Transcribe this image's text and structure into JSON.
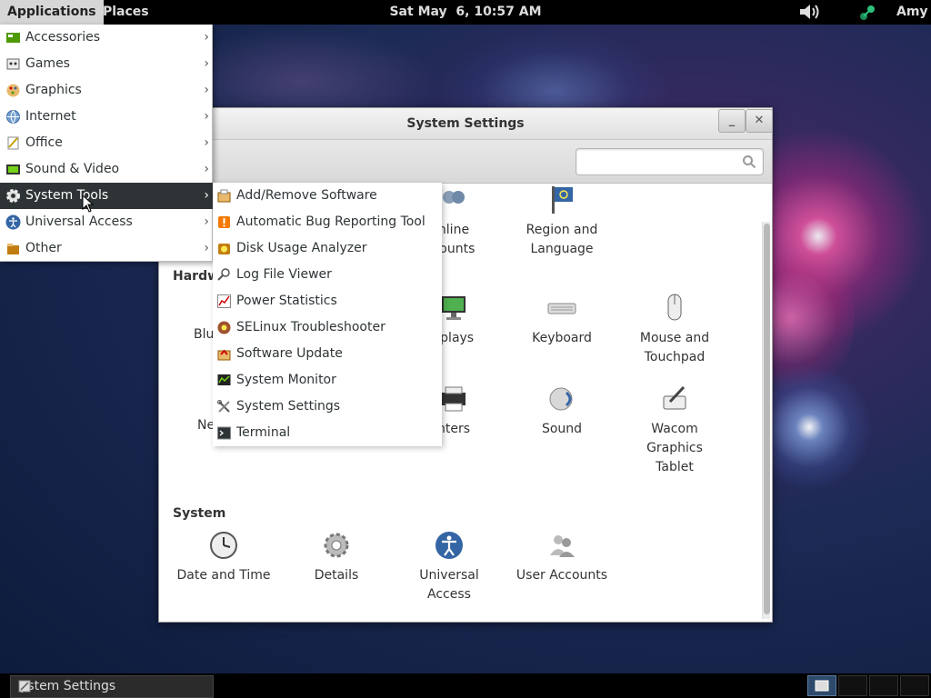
{
  "top_panel": {
    "applications": "Applications",
    "places": "Places",
    "clock": "Sat May  6, 10:57 AM",
    "user": "Amy"
  },
  "window": {
    "title": "System Settings",
    "minimize": "_",
    "close": "✕",
    "search_placeholder": ""
  },
  "sections": {
    "personal_items": [
      {
        "label_lines": [
          "nline",
          "counts"
        ]
      },
      {
        "label_lines": [
          "Region and",
          "Language"
        ]
      }
    ],
    "hardware": {
      "heading": "Hardw",
      "partial_items": [
        "Blu",
        "Ne"
      ],
      "items": [
        {
          "label_lines": [
            "splays",
            ""
          ]
        },
        {
          "label_lines": [
            "Keyboard",
            ""
          ]
        },
        {
          "label_lines": [
            "Mouse and",
            "Touchpad"
          ]
        },
        {
          "label_lines": [
            "nters",
            ""
          ]
        },
        {
          "label_lines": [
            "Sound",
            ""
          ]
        },
        {
          "label_lines": [
            "Wacom",
            "Graphics",
            "Tablet"
          ]
        }
      ]
    },
    "system": {
      "heading": "System",
      "items": [
        {
          "label_lines": [
            "Date and Time",
            ""
          ]
        },
        {
          "label_lines": [
            "Details",
            ""
          ]
        },
        {
          "label_lines": [
            "Universal",
            "Access"
          ]
        },
        {
          "label_lines": [
            "User Accounts",
            ""
          ]
        }
      ]
    }
  },
  "app_menu": {
    "items": [
      {
        "label": "Accessories",
        "icon": "accessories-icon"
      },
      {
        "label": "Games",
        "icon": "games-icon"
      },
      {
        "label": "Graphics",
        "icon": "graphics-icon"
      },
      {
        "label": "Internet",
        "icon": "internet-icon"
      },
      {
        "label": "Office",
        "icon": "office-icon"
      },
      {
        "label": "Sound & Video",
        "icon": "sound-video-icon"
      },
      {
        "label": "System Tools",
        "icon": "system-tools-icon",
        "active": true
      },
      {
        "label": "Universal Access",
        "icon": "universal-access-icon"
      },
      {
        "label": "Other",
        "icon": "other-icon"
      }
    ],
    "arrow": "›"
  },
  "system_tools_menu": {
    "items": [
      {
        "label": "Add/Remove Software"
      },
      {
        "label": "Automatic Bug Reporting Tool"
      },
      {
        "label": "Disk Usage Analyzer"
      },
      {
        "label": "Log File Viewer"
      },
      {
        "label": "Power Statistics"
      },
      {
        "label": "SELinux Troubleshooter"
      },
      {
        "label": "Software Update"
      },
      {
        "label": "System Monitor"
      },
      {
        "label": "System Settings"
      },
      {
        "label": "Terminal"
      }
    ]
  },
  "taskbar": {
    "window_button": "ystem Settings"
  },
  "colors": {
    "panel": "#000000",
    "menu_active": "#2e3436",
    "desktop": "#1c2a55"
  }
}
